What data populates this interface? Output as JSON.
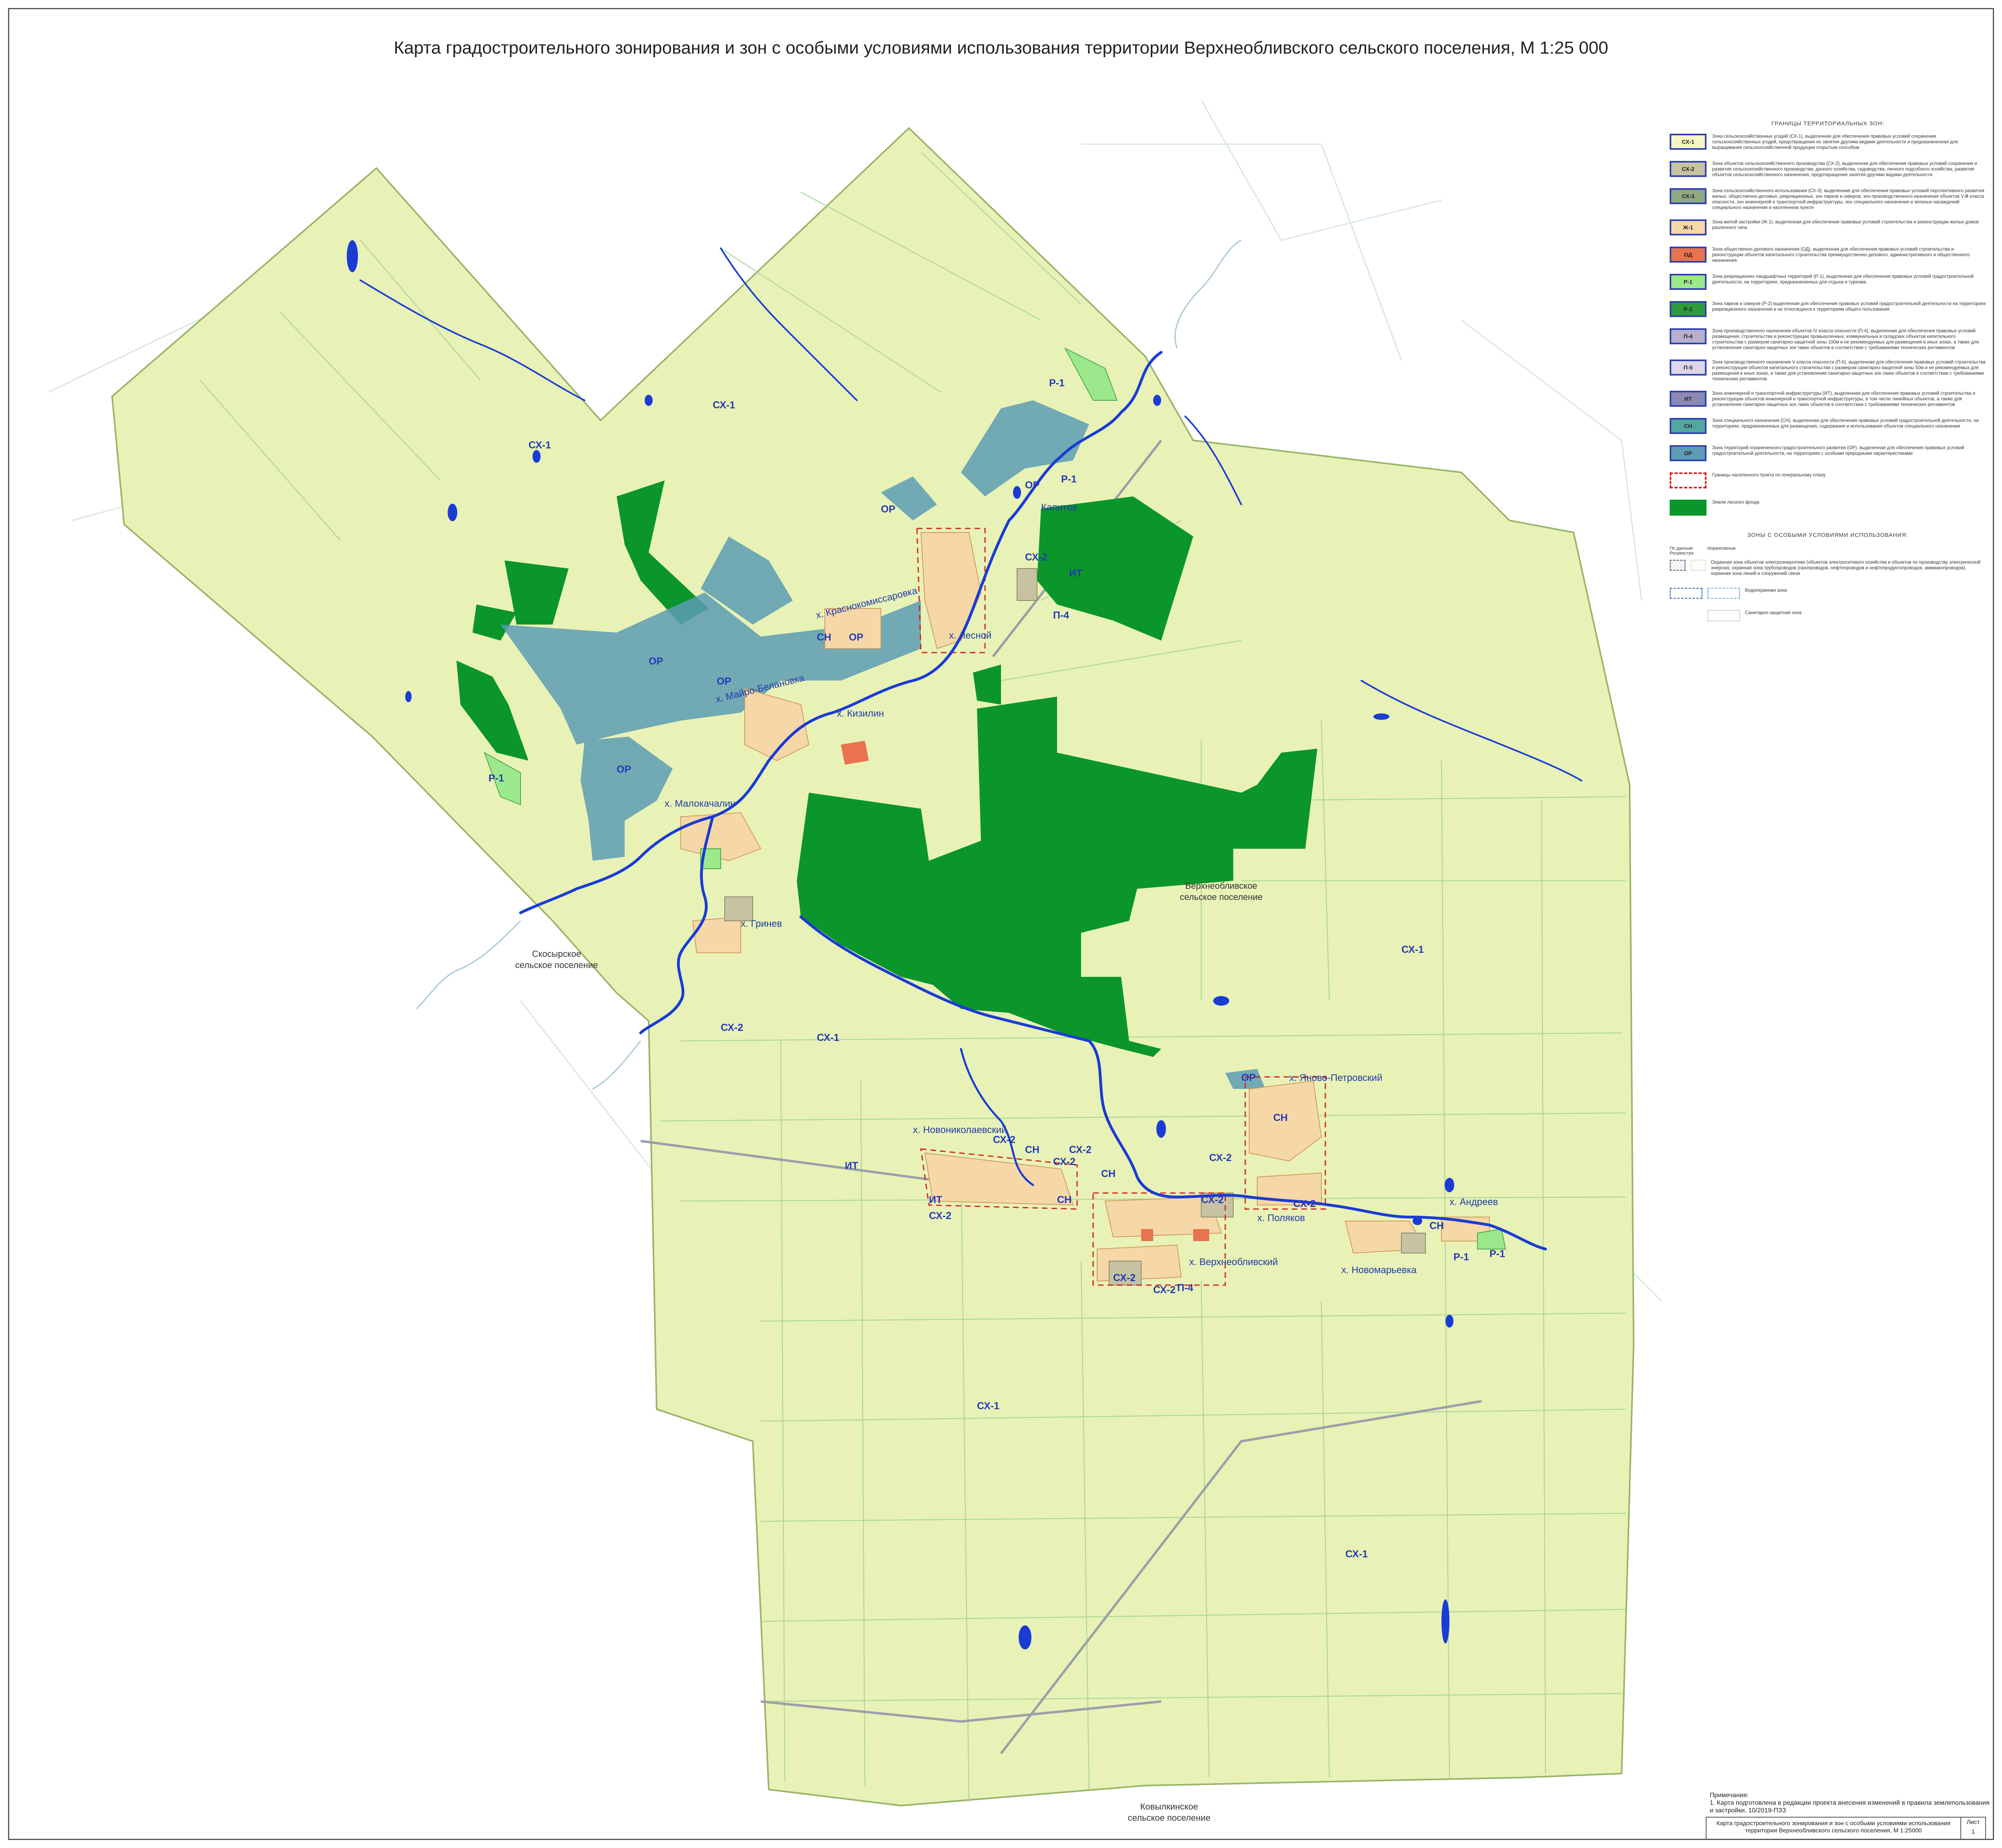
{
  "title": "Карта градостроительного зонирования и зон с особыми условиями использования территории Верхнеобливского сельского поселения, М 1:25 000",
  "colors": {
    "farmland": "#e8f2b6",
    "forest": "#0a962a",
    "protected": "#5c9cb4",
    "river": "#1a3cd4",
    "residential": "#f6d7a8",
    "road": "#9aa0a8",
    "boundary": "#2f3fb0"
  },
  "map": {
    "zone_labels": [
      "СХ-1",
      "СХ-1",
      "СХ-1",
      "СХ-1",
      "СХ-1",
      "СХ-1",
      "ОР",
      "ОР",
      "ОР",
      "ОР",
      "ОР",
      "ОР",
      "ОР",
      "Р-1",
      "Р-1",
      "Р-1",
      "Р-1",
      "Р-1",
      "ИТ",
      "ИТ",
      "ИТ",
      "П-4",
      "П-4",
      "СН",
      "СН",
      "СН",
      "СН",
      "СН",
      "СН",
      "СХ-2",
      "СХ-2",
      "СХ-2",
      "СХ-2",
      "СХ-2",
      "СХ-2",
      "СХ-2",
      "СХ-2",
      "СХ-2",
      "СХ-2",
      "СХ-2"
    ],
    "settlements": [
      "Капитов",
      "х. Краснокомиссаровка",
      "х. Лесной",
      "х. Майро-Белановка",
      "х. Кизилин",
      "х. Малокачалин",
      "х. Гринев",
      "х. Яново-Петровский",
      "х. Новониколаевский",
      "х. Андреев",
      "х. Поляков",
      "х. Верхнеобливский",
      "х. Новомарьевка"
    ],
    "admin_areas": [
      {
        "line1": "Верхнеобливское",
        "line2": "сельское поселение"
      },
      {
        "line1": "Скосырское",
        "line2": "сельское поселение"
      },
      {
        "line1": "Ковылкинское",
        "line2": "сельское поселение"
      }
    ]
  },
  "legend": {
    "heading": "ГРАНИЦЫ ТЕРРИТОРИАЛЬНЫХ ЗОН:",
    "items": [
      {
        "code": "СХ-1",
        "color": "#f5f6c4",
        "text": "Зона сельскохозяйственных угодий (СХ-1), выделенная для обеспечения правовых условий сохранения сельскохозяйственных угодий, предотвращения их занятия другими видами деятельности и предназначенная для выращивания сельскохозяйственной продукции открытым способом"
      },
      {
        "code": "СХ-2",
        "color": "#c7c2a2",
        "text": "Зона объектов сельскохозяйственного производства (СХ-2), выделенная для обеспечения правовых условий сохранения и развития сельскохозяйственного производства, дачного хозяйства, садоводства, личного подсобного хозяйства, развития объектов сельскохозяйственного назначения, предотвращения занятия другими видами деятельности"
      },
      {
        "code": "СХ-3",
        "color": "#8fa880",
        "text": "Зона сельскохозяйственного использования (СХ-3), выделенная для обеспечения правовых условий перспективного развития жилых, общественно-деловых, рекреационных, зон парков и скверов, зон производственного назначения объектов V-Ⅲ класса опасности, зон инженерной и транспортной инфраструктуры, зон специального назначения и зеленых насаждений специального назначения в населенном пункте"
      },
      {
        "code": "Ж-1",
        "color": "#f6d7a8",
        "text": "Зона жилой застройки (Ж-1), выделенная для обеспечения правовых условий строительства и реконструкции жилых домов различного типа"
      },
      {
        "code": "ОД",
        "color": "#e8734e",
        "text": "Зона общественно-делового назначения (ОД), выделенная для обеспечения правовых условий строительства и реконструкции объектов капитального строительства преимущественно делового, административного и общественного назначения"
      },
      {
        "code": "Р-1",
        "color": "#9ce88c",
        "text": "Зона рекреационно-ландшафтных территорий (Р-1), выделенная для обеспечения правовых условий градостроительной деятельности, на территориях, предназначенных для отдыха и туризма"
      },
      {
        "code": "Р-2",
        "color": "#2e9a3a",
        "text": "Зона парков и скверов (Р-2) выделенная для обеспечения правовых условий градостроительной деятельности на территориях рекреационного назначения и не относящихся к территориям общего пользования"
      },
      {
        "code": "П-4",
        "color": "#b6b0cc",
        "text": "Зона производственного назначения объектов IV класса опасности (П-4), выделенная для обеспечения правовых условий размещения, строительства и реконструкции промышленных, коммунальных и складских объектов капитального строительства с размером санитарно-защитной зоны 100м и не рекомендуемых для размещения в иных зонах, а также для установления санитарно-защитных зон таких объектов в соответствии с требованиями технических регламентов"
      },
      {
        "code": "П-5",
        "color": "#dcd8e8",
        "text": "Зона производственного назначения V класса опасности (П-5), выделенная для обеспечения правовых условий строительства и реконструкции объектов капитального строительства с размером санитарно-защитной зоны 50м и не рекомендуемых для размещения в иных зонах, а также для установления санитарно-защитных зон таких объектов в соответствии с требованиями технических регламентов"
      },
      {
        "code": "ИТ",
        "color": "#8a8ab4",
        "text": "Зона инженерной и транспортной инфраструктуры (ИТ), выделенная для обеспечения правовых условий строительства и реконструкции объектов инженерной и транспортной инфраструктуры, в том числе линейных объектов, а также для установления санитарно-защитных зон таких объектов в соответствии с требованиями технических регламентов"
      },
      {
        "code": "СН",
        "color": "#52a8a0",
        "text": "Зона специального назначения (СН), выделенная для обеспечения правовых условий градостроительной деятельности, на территориях, предназначенных для размещения, содержания и использования объектов специального назначения"
      },
      {
        "code": "ОР",
        "color": "#5c9cb4",
        "text": "Зона территорий ограниченного градостроительного развития (ОР), выделенная для обеспечения правовых условий градостроительной деятельности, на территориях с особыми природными характеристиками"
      }
    ],
    "settlement_boundary_text": "Границы населенного пункта по генеральному плану",
    "forest_text": "Земли лесного фонда",
    "zones_heading": "ЗОНЫ С ОСОБЫМИ УСЛОВИЯМИ ИСПОЛЬЗОВАНИЯ:",
    "col1": "По данным Росреестра",
    "col2": "Нормативные",
    "special_zones": [
      {
        "text": "Охранная зона объектов электроэнергетики (объектов электросетевого хозяйства и объектов по производству электрической энергии), охранная зона трубопроводов (газопроводов, нефтепроводов и нефтепродуктопроводов, аммиакопроводов), охранная зона линий и сооружений связи"
      },
      {
        "text": "Водоохранная зона"
      },
      {
        "text": "Санитарно-защитная зона"
      }
    ]
  },
  "notes": {
    "heading": "Примечания:",
    "text": "1. Карта подготовлена в редакции проекта внесения изменений в правила землепользования и застройки. 10/2019-ПЗЗ"
  },
  "stamp": {
    "text": "Карта градостроительного зонирования и зон с особыми условиями использования территории Верхнеобливского сельского поселения, М 1:25000",
    "sheet_label": "Лист",
    "sheet_number": "1"
  }
}
